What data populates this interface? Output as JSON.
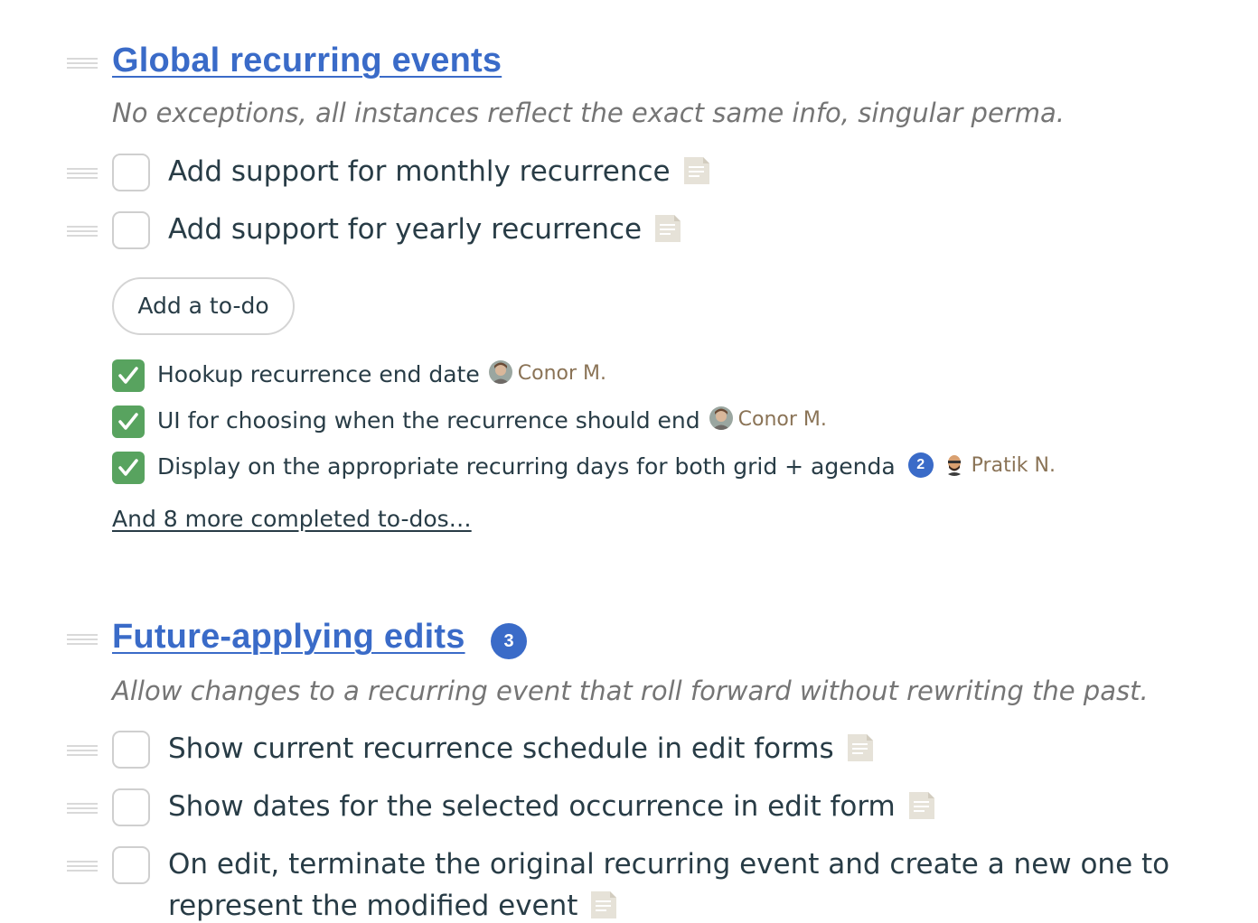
{
  "lists": [
    {
      "title": "Global recurring events",
      "description": "No exceptions, all instances reflect the exact same info, singular perma.",
      "todos": [
        {
          "label": "Add support for monthly recurrence",
          "icon": "note-icon"
        },
        {
          "label": "Add support for yearly recurrence",
          "icon": "note-icon"
        }
      ],
      "add_todo_label": "Add a to-do",
      "completed": [
        {
          "label": "Hookup recurrence end date",
          "assignee": "Conor M."
        },
        {
          "label": "UI for choosing when the recurrence should end",
          "assignee": "Conor M."
        },
        {
          "label": "Display on the appropriate recurring days for both grid + agenda",
          "comment_count": "2",
          "assignee": "Pratik N."
        }
      ],
      "more_completed_link": "And 8 more completed to-dos…"
    },
    {
      "title": "Future-applying edits",
      "badge_count": "3",
      "description": "Allow changes to a recurring event that roll forward without rewriting the past.",
      "todos": [
        {
          "label": "Show current recurrence schedule in edit forms",
          "icon": "note-icon"
        },
        {
          "label": "Show dates for the selected occurrence in edit form",
          "icon": "note-icon"
        },
        {
          "label": "On edit, terminate the original recurring event and create a new one to",
          "icon": "note-icon"
        },
        {
          "label": "represent the modified event",
          "icon": "note-icon"
        }
      ]
    }
  ],
  "colors": {
    "link_blue": "#3a6bc8",
    "done_green": "#58a35f",
    "assignee_brown": "#8a7356",
    "text": "#283c46",
    "muted": "#757575"
  }
}
